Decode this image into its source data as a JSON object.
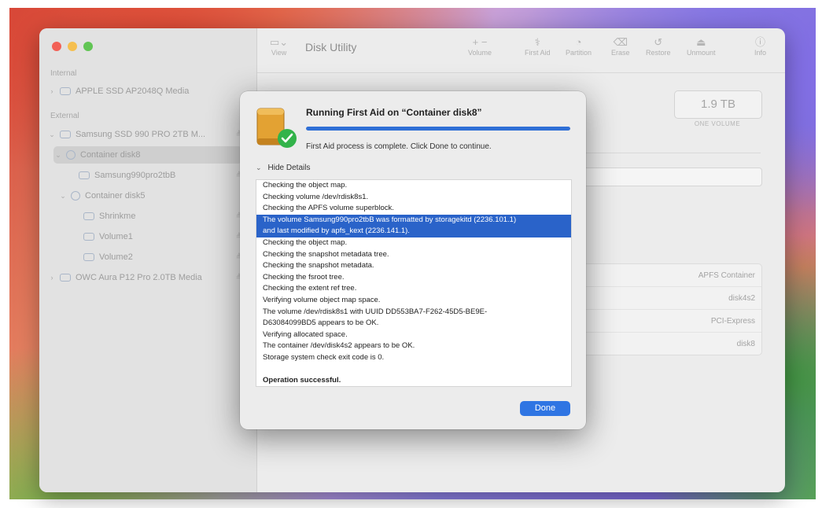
{
  "app": {
    "title": "Disk Utility"
  },
  "toolbar": {
    "view_label": "View",
    "items": [
      {
        "label": "Volume",
        "icon": "plus-minus-icon"
      },
      {
        "label": "First Aid",
        "icon": "stethoscope-icon"
      },
      {
        "label": "Partition",
        "icon": "pie-icon"
      },
      {
        "label": "Erase",
        "icon": "eraser-icon"
      },
      {
        "label": "Restore",
        "icon": "restore-icon"
      },
      {
        "label": "Unmount",
        "icon": "eject-icon"
      },
      {
        "label": "Info",
        "icon": "info-icon"
      }
    ]
  },
  "sidebar": {
    "internal_label": "Internal",
    "external_label": "External",
    "internal_items": [
      {
        "label": "APPLE SSD AP2048Q Media",
        "extra": ""
      }
    ],
    "external_items": [
      {
        "label": "Samsung SSD 990 PRO 2TB M...",
        "extra": "≜"
      },
      {
        "label": "Container disk8",
        "extra": ""
      },
      {
        "label": "Samsung990pro2tbB",
        "extra": "≜"
      },
      {
        "label": "Container disk5",
        "extra": ""
      },
      {
        "label": "Shrinkme",
        "extra": "≜"
      },
      {
        "label": "Volume1",
        "extra": "≜"
      },
      {
        "label": "Volume2",
        "extra": "≜"
      },
      {
        "label": "OWC Aura P12 Pro 2.0TB Media",
        "extra": "≜"
      }
    ]
  },
  "content": {
    "size_value": "1.9 TB",
    "size_sub": "ONE VOLUME",
    "info_rows": [
      "APFS Container",
      "disk4s2",
      "PCI-Express",
      "disk8"
    ]
  },
  "dialog": {
    "title": "Running First Aid on “Container disk8”",
    "progress": 1.0,
    "status": "First Aid process is complete. Click Done to continue.",
    "details_toggle": "Hide Details",
    "log_lines": [
      {
        "text": "Checking the object map.",
        "style": ""
      },
      {
        "text": "Checking volume /dev/rdisk8s1.",
        "style": ""
      },
      {
        "text": "Checking the APFS volume superblock.",
        "style": ""
      },
      {
        "text": "The volume Samsung990pro2tbB was formatted by storagekitd (2236.101.1)",
        "style": "sel"
      },
      {
        "text": "and last modified by apfs_kext (2236.141.1).",
        "style": "sel"
      },
      {
        "text": "Checking the object map.",
        "style": ""
      },
      {
        "text": "Checking the snapshot metadata tree.",
        "style": ""
      },
      {
        "text": "Checking the snapshot metadata.",
        "style": ""
      },
      {
        "text": "Checking the fsroot tree.",
        "style": ""
      },
      {
        "text": "Checking the extent ref tree.",
        "style": ""
      },
      {
        "text": "Verifying volume object map space.",
        "style": ""
      },
      {
        "text": "The volume /dev/rdisk8s1 with UUID DD553BA7-F262-45D5-BE9E-",
        "style": ""
      },
      {
        "text": "D63084099BD5 appears to be OK.",
        "style": ""
      },
      {
        "text": "Verifying allocated space.",
        "style": ""
      },
      {
        "text": "The container /dev/disk4s2 appears to be OK.",
        "style": ""
      },
      {
        "text": "Storage system check exit code is 0.",
        "style": ""
      },
      {
        "text": "",
        "style": "blank"
      },
      {
        "text": "Operation successful.",
        "style": "bold"
      }
    ],
    "done_label": "Done"
  }
}
